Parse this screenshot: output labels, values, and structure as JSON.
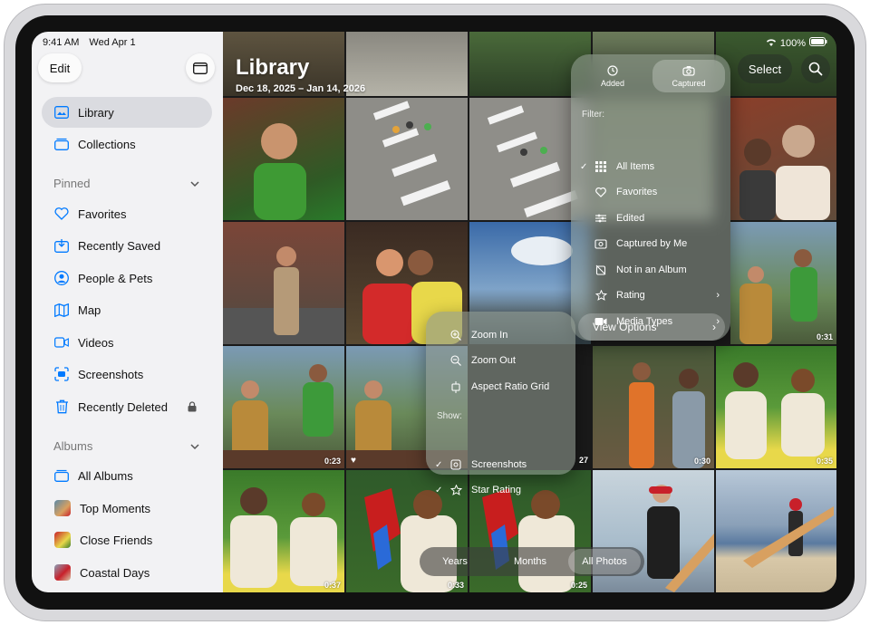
{
  "status": {
    "time": "9:41 AM",
    "date": "Wed Apr 1",
    "battery": "100%"
  },
  "sidebar": {
    "edit_label": "Edit",
    "top_items": [
      {
        "label": "Library",
        "icon": "photo-library-icon"
      },
      {
        "label": "Collections",
        "icon": "collections-icon"
      }
    ],
    "pinned_header": "Pinned",
    "pinned_items": [
      {
        "label": "Favorites",
        "icon": "heart-icon"
      },
      {
        "label": "Recently Saved",
        "icon": "recently-saved-icon"
      },
      {
        "label": "People & Pets",
        "icon": "person-icon"
      },
      {
        "label": "Map",
        "icon": "map-icon"
      },
      {
        "label": "Videos",
        "icon": "video-icon"
      },
      {
        "label": "Screenshots",
        "icon": "screenshot-icon"
      },
      {
        "label": "Recently Deleted",
        "icon": "trash-icon"
      }
    ],
    "albums_header": "Albums",
    "album_items": [
      {
        "label": "All Albums",
        "icon": "albums-icon"
      },
      {
        "label": "Top Moments",
        "icon": "album-thumbnail"
      },
      {
        "label": "Close Friends",
        "icon": "album-thumbnail"
      },
      {
        "label": "Coastal Days",
        "icon": "album-thumbnail"
      }
    ]
  },
  "library": {
    "title": "Library",
    "date_range": "Dec 18, 2025 – Jan 14, 2026"
  },
  "toolbar": {
    "select_label": "Select"
  },
  "filter_menu": {
    "sort_options": [
      {
        "label": "Added"
      },
      {
        "label": "Captured"
      }
    ],
    "filter_header": "Filter:",
    "items": [
      {
        "label": "All Items",
        "icon": "grid-icon",
        "checked": "✓"
      },
      {
        "label": "Favorites",
        "icon": "heart-icon"
      },
      {
        "label": "Edited",
        "icon": "sliders-icon"
      },
      {
        "label": "Captured by Me",
        "icon": "camera-photo-icon"
      },
      {
        "label": "Not in an Album",
        "icon": "no-album-icon"
      },
      {
        "label": "Rating",
        "icon": "star-icon",
        "arrow": "›"
      },
      {
        "label": "Media Types",
        "icon": "media-types-icon",
        "arrow": "›"
      }
    ],
    "view_options": "View Options",
    "view_options_arrow": "›"
  },
  "view_submenu": {
    "items": [
      {
        "label": "Zoom In",
        "icon": "zoom-in-icon"
      },
      {
        "label": "Zoom Out",
        "icon": "zoom-out-icon"
      },
      {
        "label": "Aspect Ratio Grid",
        "icon": "aspect-ratio-icon"
      }
    ],
    "show_header": "Show:",
    "show_items": [
      {
        "label": "Screenshots",
        "icon": "screenshot-icon",
        "checked": "✓"
      },
      {
        "label": "Star Rating",
        "icon": "star-icon",
        "checked": "✓"
      }
    ]
  },
  "durations": [
    "0:31",
    "0:23",
    "27",
    "0:30",
    "0:35",
    "0:37",
    "0:33",
    "0:25"
  ],
  "bottom_tabs": [
    {
      "label": "Years"
    },
    {
      "label": "Months"
    },
    {
      "label": "All Photos"
    }
  ],
  "colors": {
    "accent": "#007aff",
    "sidebar_bg": "#f2f2f4",
    "menu_bg": "#96a096"
  }
}
